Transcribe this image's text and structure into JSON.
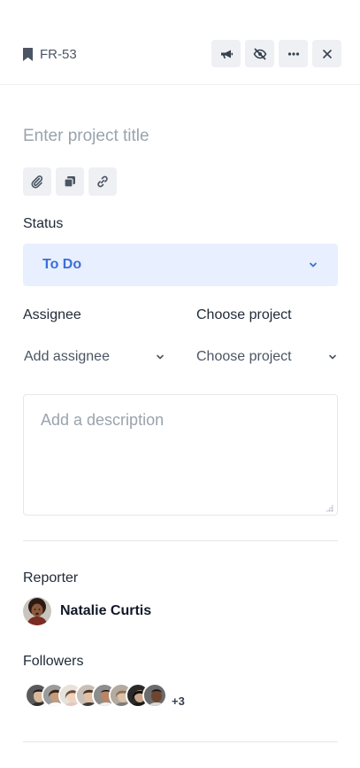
{
  "header": {
    "ticket_id": "FR-53",
    "tools": [
      {
        "name": "megaphone-icon",
        "label": "announce"
      },
      {
        "name": "eye-off-icon",
        "label": "unwatch"
      },
      {
        "name": "more-icon",
        "label": "more"
      },
      {
        "name": "close-icon",
        "label": "close"
      }
    ]
  },
  "title": {
    "placeholder": "Enter project title",
    "value": ""
  },
  "attachments": {
    "icons": [
      "paperclip-icon",
      "copy-icon",
      "link-icon"
    ]
  },
  "status": {
    "label": "Status",
    "value": "To Do"
  },
  "assignee": {
    "label": "Assignee",
    "value": "Add assignee"
  },
  "project": {
    "label": "Choose project",
    "value": "Choose project"
  },
  "description": {
    "placeholder": "Add a description"
  },
  "reporter": {
    "label": "Reporter",
    "name": "Natalie Curtis"
  },
  "followers": {
    "label": "Followers",
    "more_count": "+3"
  },
  "colors": {
    "accent": "#3b6fd8",
    "status_bg": "#e8efff",
    "tool_bg": "#eef0f3"
  }
}
